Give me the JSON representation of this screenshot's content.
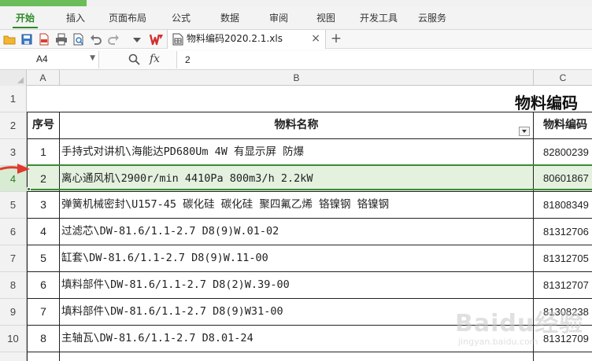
{
  "ribbon": {
    "tabs": [
      {
        "label": "开始",
        "active": true
      },
      {
        "label": "插入",
        "active": false
      },
      {
        "label": "页面布局",
        "active": false
      },
      {
        "label": "公式",
        "active": false
      },
      {
        "label": "数据",
        "active": false
      },
      {
        "label": "审阅",
        "active": false
      },
      {
        "label": "视图",
        "active": false
      },
      {
        "label": "开发工具",
        "active": false
      },
      {
        "label": "云服务",
        "active": false
      }
    ]
  },
  "quick_access": {
    "icons": [
      "folder-open-icon",
      "save-icon",
      "pdf-export-icon",
      "print-icon",
      "print-preview-icon",
      "undo-icon",
      "redo-icon",
      "dropdown-icon",
      "wps-logo-icon"
    ]
  },
  "document_tab": {
    "title": "物料编码2020.2.1.xls",
    "close_label": "×",
    "add_label": "+"
  },
  "formula_bar": {
    "cell_ref": "A4",
    "fx_label": "fx",
    "zoom_label": "Q",
    "value": "2"
  },
  "columns": [
    "A",
    "B",
    "C"
  ],
  "sheet": {
    "title": "物料编码",
    "header": {
      "seq": "序号",
      "name": "物料名称",
      "code": "物料编码"
    },
    "row_numbers": [
      "1",
      "2",
      "3",
      "4",
      "5",
      "6",
      "7",
      "8",
      "9",
      "10"
    ],
    "rows": [
      {
        "seq": "1",
        "name": "手持式对讲机\\海能达PD680Um 4W 有显示屏 防爆",
        "code": "82800239"
      },
      {
        "seq": "2",
        "name": "离心通风机\\2900r/min 4410Pa 800m3/h 2.2kW",
        "code": "80601867"
      },
      {
        "seq": "3",
        "name": "弹簧机械密封\\U157-45 碳化硅 碳化硅 聚四氟乙烯 铬镍钢 铬镍钢",
        "code": "81808349"
      },
      {
        "seq": "4",
        "name": "过滤芯\\DW-81.6/1.1-2.7 D8(9)W.01-02",
        "code": "81312706"
      },
      {
        "seq": "5",
        "name": "缸套\\DW-81.6/1.1-2.7 D8(9)W.11-00",
        "code": "81312705"
      },
      {
        "seq": "6",
        "name": "填料部件\\DW-81.6/1.1-2.7 D8(2)W.39-00",
        "code": "81312707"
      },
      {
        "seq": "7",
        "name": "填料部件\\DW-81.6/1.1-2.7 D8(9)W31-00",
        "code": "81308238"
      },
      {
        "seq": "8",
        "name": "主轴瓦\\DW-81.6/1.1-2.7 D8.01-24",
        "code": "81312709"
      }
    ],
    "selected_row": "4"
  },
  "watermark": {
    "text": "Baidu经验",
    "sub": "jingyan.baidu.com"
  },
  "colors": {
    "accent_green": "#2d8a27",
    "selection_fill": "#e4f1df",
    "arrow_red": "#e03a2f"
  }
}
